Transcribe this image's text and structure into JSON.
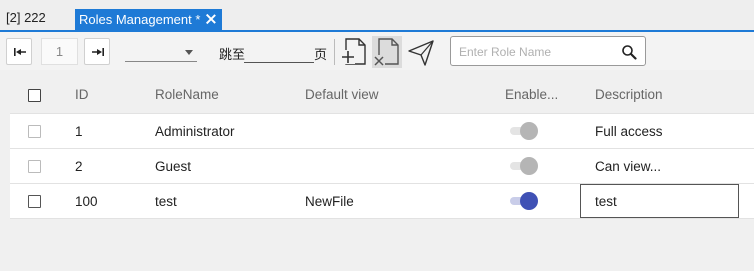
{
  "tabs": {
    "inactive_label": "[2] 222",
    "active_label": "Roles Management *"
  },
  "toolbar": {
    "page_number": "1",
    "page_size_value": "",
    "jump_label": "跳至",
    "jump_value": "",
    "page_suffix": "页",
    "search_placeholder": "Enter Role Name",
    "icons": [
      "first-page-icon",
      "last-page-icon",
      "add-document-icon",
      "delete-document-icon",
      "send-icon",
      "search-icon"
    ]
  },
  "grid": {
    "columns": {
      "id": "ID",
      "role_name": "RoleName",
      "default_view": "Default view",
      "enabled": "Enable...",
      "description": "Description"
    },
    "rows": [
      {
        "id": "1",
        "role_name": "Administrator",
        "default_view": "",
        "enabled": false,
        "description": "Full access"
      },
      {
        "id": "2",
        "role_name": "Guest",
        "default_view": "",
        "enabled": false,
        "description": "Can view..."
      },
      {
        "id": "100",
        "role_name": "test",
        "default_view": "NewFile",
        "enabled": true,
        "description": "test"
      }
    ]
  },
  "colors": {
    "accent": "#1e7ad6",
    "toggle_on": "#3f51b5",
    "toggle_off": "#b5b5b5"
  }
}
